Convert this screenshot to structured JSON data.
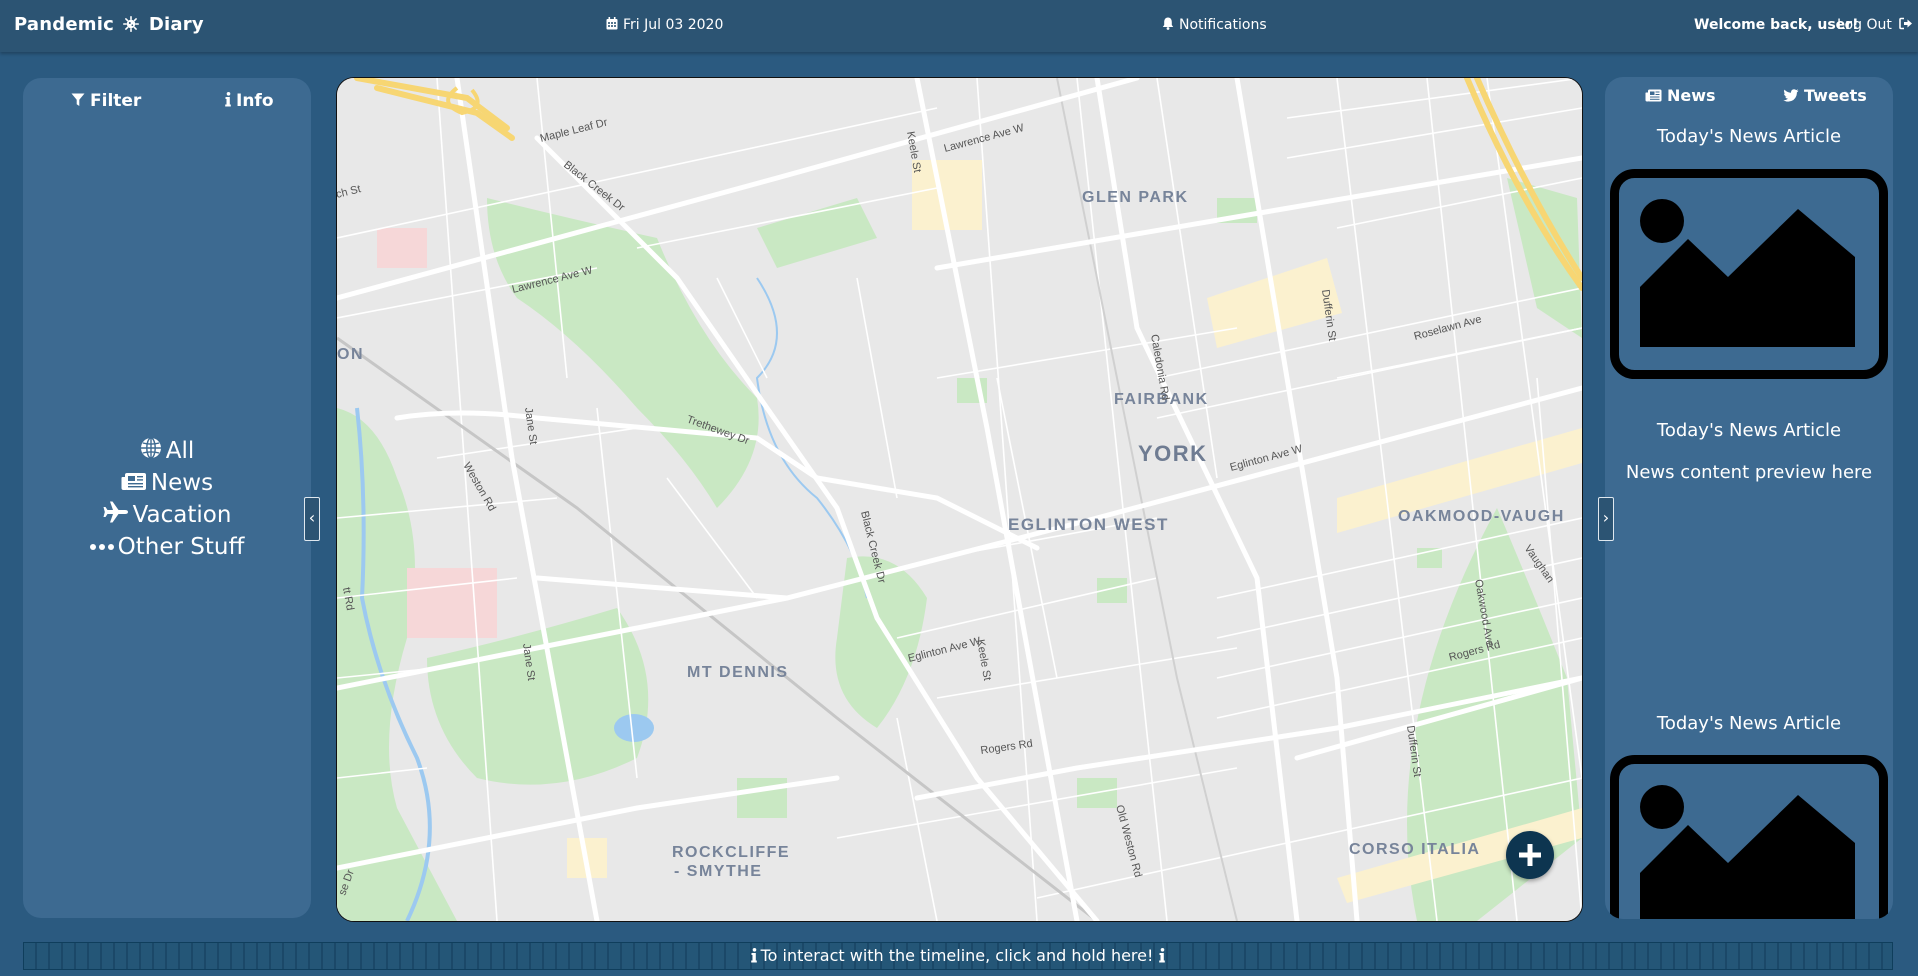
{
  "header": {
    "brand_part1": "Pandemic",
    "brand_part2": "Diary",
    "brand_icon": "virus-icon",
    "date": "Fri Jul 03 2020",
    "date_icon": "calendar-icon",
    "notifications": "Notifications",
    "notifications_icon": "bell-icon",
    "welcome": "Welcome back, user!",
    "logout": "Log Out",
    "logout_icon": "sign-out-icon"
  },
  "left_panel": {
    "tabs": [
      {
        "label": "Filter",
        "icon": "filter-icon"
      },
      {
        "label": "Info",
        "icon": "info-icon"
      }
    ],
    "filters": [
      {
        "label": "All",
        "icon": "globe-icon"
      },
      {
        "label": "News",
        "icon": "newspaper-icon"
      },
      {
        "label": "Vacation",
        "icon": "plane-icon"
      },
      {
        "label": "Other Stuff",
        "icon": "ellipsis-icon"
      }
    ],
    "collapse_glyph": "‹"
  },
  "right_panel": {
    "tabs": [
      {
        "label": "News",
        "icon": "newspaper-icon"
      },
      {
        "label": "Tweets",
        "icon": "twitter-icon"
      }
    ],
    "articles": [
      {
        "title": "Today's News Article",
        "thumbnail_icon": "image-placeholder-icon"
      },
      {
        "title": "Today's News Article",
        "preview": "News content preview here"
      },
      {
        "title": "Today's News Article",
        "thumbnail_icon": "image-placeholder-icon"
      }
    ],
    "collapse_glyph": "›"
  },
  "map": {
    "neighbourhoods": [
      "GLEN PARK",
      "FAIRBANK",
      "YORK",
      "EGLINTON WEST",
      "OAKMOOD-VAUGH",
      "MT DENNIS",
      "ROCKCLIFFE",
      "- SMYTHE",
      "CORSO ITALIA",
      "ON"
    ],
    "streets": [
      "Maple Leaf Dr",
      "Lawrence Ave W",
      "Black Creek Dr",
      "Keele St",
      "Dufferin St",
      "Roselawn Ave",
      "Caledonia Rd",
      "Trethewey Dr",
      "Jane St",
      "Weston Rd",
      "Eglinton Ave W",
      "Rogers Rd",
      "Old Weston Rd",
      "Oakwood Ave",
      "Vaughan",
      "ch St",
      "tt Rd",
      "se Dr"
    ],
    "add_button_icon": "plus-icon"
  },
  "timeline": {
    "label": "To interact with the timeline, click and hold here!",
    "icon": "info-icon"
  },
  "colors": {
    "page_bg": "#2b5a80",
    "topbar_bg": "#2c5473",
    "panel_bg": "#3d6a91",
    "fab_bg": "#0d3550",
    "map_park": "#c9e8c3",
    "map_highway": "#f7d673",
    "map_land": "#e8e8e8"
  }
}
